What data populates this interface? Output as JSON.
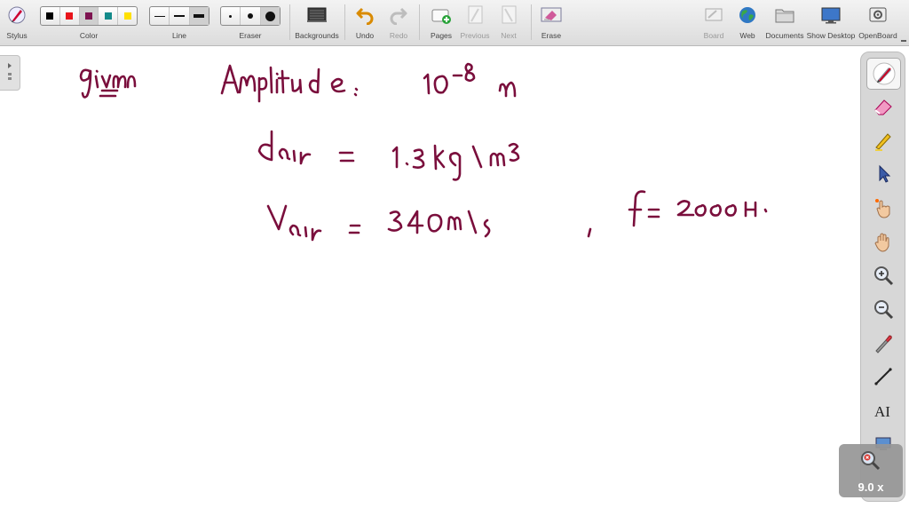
{
  "toolbar": {
    "stylus": "Stylus",
    "color": "Color",
    "line": "Line",
    "eraser": "Eraser",
    "backgrounds": "Backgrounds",
    "undo": "Undo",
    "redo": "Redo",
    "pages": "Pages",
    "previous": "Previous",
    "next": "Next",
    "erase": "Erase",
    "board": "Board",
    "web": "Web",
    "documents": "Documents",
    "show_desktop": "Show Desktop",
    "openboard": "OpenBoard"
  },
  "colors": {
    "palette": [
      "#000000",
      "#e8141b",
      "#7e1451",
      "#138a8a",
      "#ffe000"
    ],
    "ink": "#7a0e3c"
  },
  "tools": [
    "pen-icon",
    "eraser-icon",
    "highlighter-icon",
    "pointer-icon",
    "laser-pointer-icon",
    "hand-icon",
    "zoom-in-icon",
    "zoom-out-icon",
    "capture-icon",
    "line-tool-icon",
    "text-tool-icon"
  ],
  "zoom": {
    "value": "9.0 x"
  }
}
